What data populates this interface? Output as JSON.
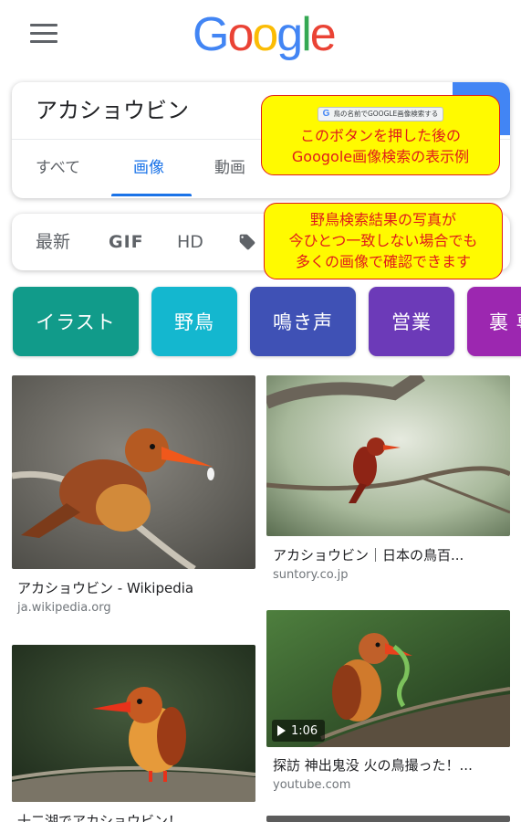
{
  "header": {
    "logo_letters": [
      "G",
      "o",
      "o",
      "g",
      "l",
      "e"
    ],
    "logo_colors": [
      "#4285f4",
      "#ea4335",
      "#fbbc05",
      "#4285f4",
      "#34a853",
      "#ea4335"
    ],
    "menu_icon": "hamburger-menu-icon"
  },
  "search": {
    "query": "アカショウビン",
    "button_color": "#4285f4",
    "tabs": [
      {
        "label": "すべて",
        "active": false
      },
      {
        "label": "画像",
        "active": true
      },
      {
        "label": "動画",
        "active": false
      }
    ]
  },
  "filters": {
    "items": [
      "最新",
      "GIF",
      "HD"
    ],
    "tag_icon": "tag-icon"
  },
  "chips": [
    {
      "label": "イラスト",
      "color": "#119b8a"
    },
    {
      "label": "野鳥",
      "color": "#14b7cf"
    },
    {
      "label": "鳴き声",
      "color": "#3f51b5"
    },
    {
      "label": "営業",
      "color": "#6c3ab8"
    },
    {
      "label": "裏 専",
      "color": "#9c27b0"
    }
  ],
  "callouts": {
    "button_label": "鳥の名前でGOOGLE画像検索する",
    "button_icon": "google-g-icon",
    "note1": [
      "このボタンを押した後の",
      "Googole画像検索の表示例"
    ],
    "note2": [
      "野鳥検索結果の写真が",
      "今ひとつ一致しない場合でも",
      "多くの画像で確認できます"
    ],
    "fill_color": "#fffa00",
    "text_color": "#e01b1b"
  },
  "results": [
    {
      "title": "アカショウビン - Wikipedia",
      "source": "ja.wikipedia.org"
    },
    {
      "title": "アカショウビン｜日本の鳥百...",
      "source": "suntory.co.jp"
    },
    {
      "title": "探訪 神出鬼没 火の鳥撮った！...",
      "source": "youtube.com",
      "duration": "1:06"
    },
    {
      "title": "十二湖でアカショウビン！..."
    }
  ]
}
